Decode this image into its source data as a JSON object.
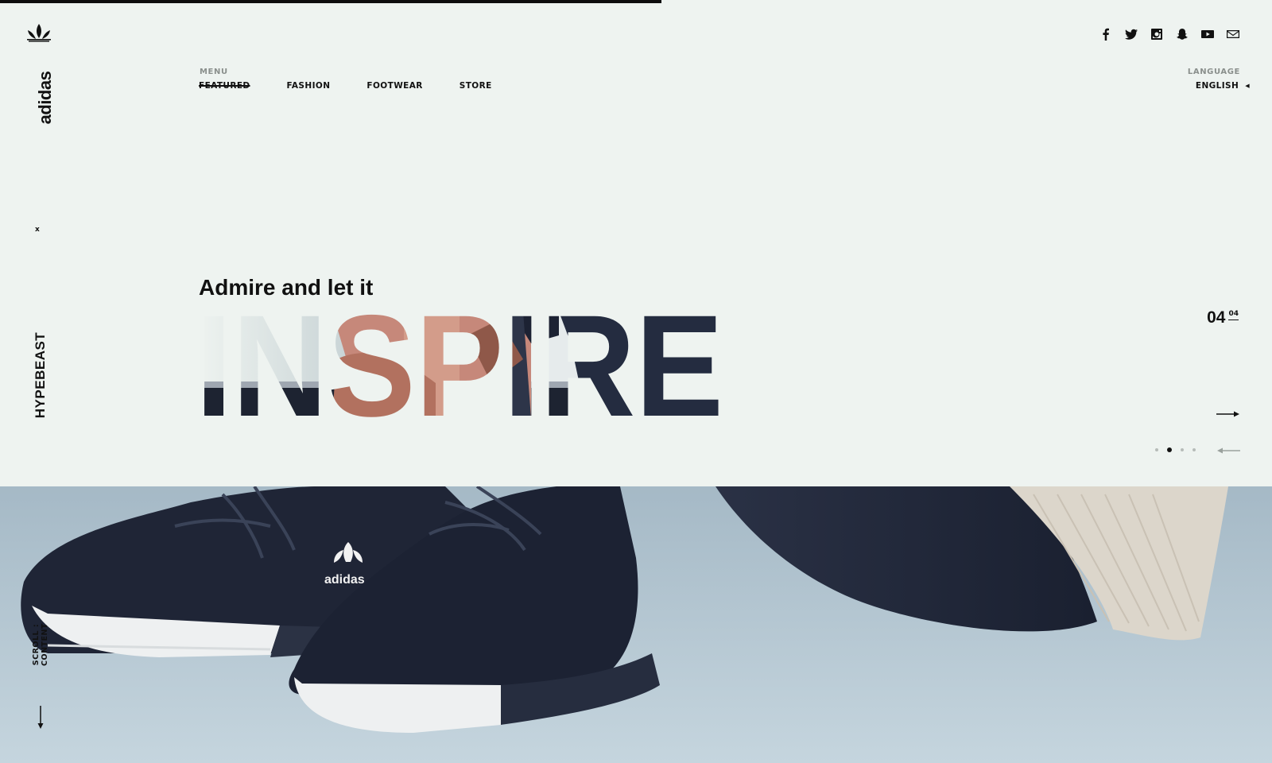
{
  "progress": {
    "fraction": 0.52
  },
  "brand": {
    "logo_icon": "trefoil-icon",
    "wordmark": "adidas",
    "collab_separator": "x",
    "partner": "HYPEBEAST"
  },
  "social": [
    {
      "name": "facebook-icon"
    },
    {
      "name": "twitter-icon"
    },
    {
      "name": "instagram-icon"
    },
    {
      "name": "snapchat-icon"
    },
    {
      "name": "youtube-icon"
    },
    {
      "name": "mail-icon"
    }
  ],
  "menu": {
    "label": "MENU",
    "items": [
      {
        "label": "FEATURED",
        "active": true
      },
      {
        "label": "FASHION",
        "active": false
      },
      {
        "label": "FOOTWEAR",
        "active": false
      },
      {
        "label": "STORE",
        "active": false
      }
    ]
  },
  "language": {
    "label": "LANGUAGE",
    "value": "ENGLISH"
  },
  "hero": {
    "subhead": "Admire and let it",
    "headline": "INSPIRE"
  },
  "slider": {
    "current": "04",
    "total": "04",
    "dots": 4,
    "active_dot": 1
  },
  "scroll": {
    "label": "SCROLL : CONTENT"
  },
  "colors": {
    "background": "#eef3f0",
    "ink": "#111111",
    "shoe": "#1e2433",
    "sole": "#f1f3f4",
    "skin": "#c98a78",
    "knit": "#ddd6cc"
  }
}
